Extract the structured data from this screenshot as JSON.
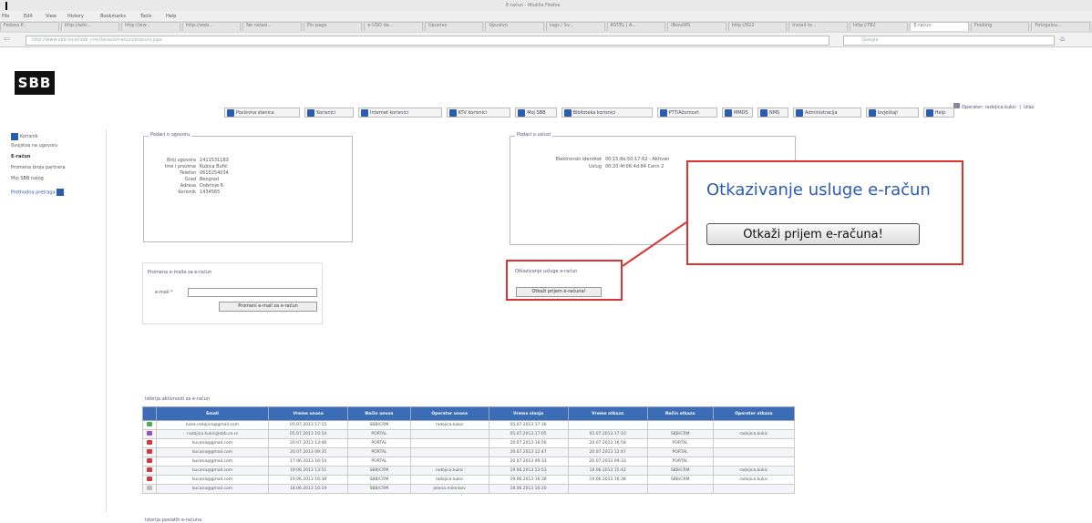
{
  "browser": {
    "window_title": "E-račun - Mozilla Firefox",
    "menu": [
      "File",
      "Edit",
      "View",
      "History",
      "Bookmarks",
      "Tools",
      "Help"
    ],
    "tabs": [
      "Fedora P...",
      "http://wiki...",
      "http://ww...",
      "http://web...",
      "Ne nalazi...",
      "Plu page",
      "e-USO de...",
      "Upustvo",
      "Upustvo",
      "tags / Sv...",
      "ASTEL | A...",
      "iBossWS",
      "http://822",
      "Install to...",
      "http://782",
      "E-račun",
      "Fooking",
      "Fotogalou..."
    ],
    "active_tab": "E-račun",
    "url": "http://www.sbb.local/sbb_crm/faces/erracuni/eracuni.jspx",
    "search_placeholder": "Google"
  },
  "header": {
    "logo": "SBB",
    "user_text": "Operater: radojica.kukic",
    "logout": "Izlaz"
  },
  "nav": [
    "Poslovna stanica",
    "Korisnici",
    "Internet korisnici",
    "KTV korisnici",
    "Moj SBB",
    "Biblioteka korisnici",
    "PTT/Ažurnost",
    "MMDS",
    "NMS",
    "Administracija",
    "Izvještaji",
    "Help"
  ],
  "sidebar": {
    "title": "Korisnik",
    "items": [
      "Svojstva na ugovoru",
      "E-račun",
      "Promena broja partnera",
      "Moj SBB nalog"
    ],
    "footer": "Prethodna pretraga"
  },
  "contract_panel": {
    "legend": "Podaci o ugovoru",
    "rows": [
      {
        "label": "Broj ugovora",
        "value": "1411531183"
      },
      {
        "label": "Ime i prezime",
        "value": "Kubica Bufić"
      },
      {
        "label": "Telefon",
        "value": "0615254034"
      },
      {
        "label": "Grad",
        "value": "Beograd"
      },
      {
        "label": "Adresa",
        "value": "Dobrinje 6"
      },
      {
        "label": "Korisnik",
        "value": "1434565"
      }
    ]
  },
  "service_panel": {
    "legend": "Podaci o usluzi",
    "rows": [
      {
        "label": "Elektronski identitet",
        "value": "00:15:8e:50:17:62 - Aktivan"
      },
      {
        "label": "Uslug",
        "value": "00:20:4f:06:4d:84 Cenn 2"
      }
    ]
  },
  "email_change": {
    "title": "Promena e-maila za e-račun",
    "label": "e-mail",
    "button": "Promeni e-mail za e-račun"
  },
  "cancel_small": {
    "title": "Otkazivanje usluge e-račun",
    "button": "Otkaži prijem e-računa!"
  },
  "callout": {
    "title": "Otkazivanje usluge e-račun",
    "button": "Otkaži prijem e-računa!"
  },
  "history": {
    "title": "Istorija aktivnosti za e-račun",
    "columns": [
      "Email",
      "Vreme unosa",
      "Način unosa",
      "Operater unosa",
      "Vreme slanja",
      "Vreme otkaza",
      "Način otkaza",
      "Operater otkaza"
    ],
    "rows": [
      {
        "status": "green",
        "cells": [
          "kuka.radojica@gmail.com",
          "05.07.2013 17:15",
          "SBB/CRM",
          "radojica.kukic",
          "05.07.2013 17:16",
          "",
          "",
          ""
        ]
      },
      {
        "status": "purple",
        "cells": [
          "radojica.kukic@sbb.co.rs",
          "05.07.2013 16:54",
          "PORTAL",
          "",
          "05.07.2013 17:05",
          "05.07.2013 17:10",
          "SBB/CRM",
          "radojica.kukic"
        ]
      },
      {
        "status": "red",
        "cells": [
          "kucana@gmail.com",
          "20.07.2013 13:46",
          "PORTAL",
          "",
          "20.07.2013 16:56",
          "20.07.2013 16:58",
          "PORTAL",
          ""
        ]
      },
      {
        "status": "red",
        "cells": [
          "kucana@gmail.com",
          "20.07.2013 09:35",
          "PORTAL",
          "",
          "20.07.2013 12:47",
          "20.07.2013 12:47",
          "PORTAL",
          ""
        ]
      },
      {
        "status": "red",
        "cells": [
          "kucana@gmail.com",
          "17.06.2013 16:54",
          "PORTAL",
          "",
          "20.07.2013 09:33",
          "20.07.2013 09:33",
          "PORTAL",
          ""
        ]
      },
      {
        "status": "red",
        "cells": [
          "kucana@gmail.com",
          "19.06.2013 13:51",
          "SBB/CRM",
          "radojica.kukic",
          "19.06.2013 13:53",
          "19.06.2013 15:42",
          "SBB/CRM",
          "radojica.kukic"
        ]
      },
      {
        "status": "red",
        "cells": [
          "kucana@gmail.com",
          "19.06.2013 16:38",
          "SBB/CRM",
          "radojica.kukic",
          "19.06.2013 16:38",
          "19.06.2013 16:38",
          "SBB/CRM",
          "radojica.kukic"
        ]
      },
      {
        "status": "gray",
        "cells": [
          "kucana@gmail.com",
          "18.06.2013 16:19",
          "SBB/CRM",
          "jelena.milenkov",
          "18.06.2013 16:20",
          "",
          "",
          ""
        ]
      }
    ],
    "status_colors": {
      "green": "#4caf50",
      "purple": "#9b4fc0",
      "red": "#d9383a",
      "gray": "#bbbbbb"
    }
  },
  "footer_section": "Istorija poslatih e-računa"
}
